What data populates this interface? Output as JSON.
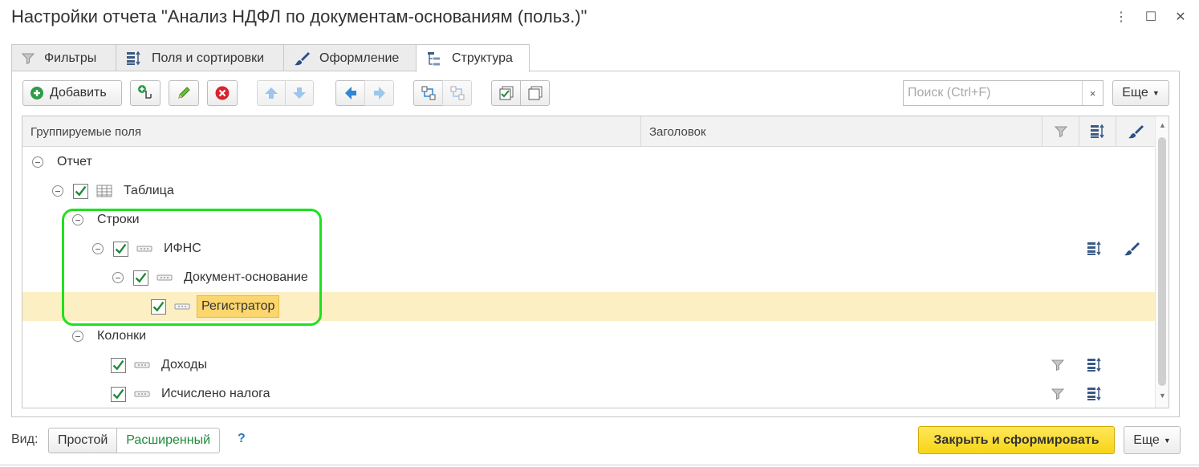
{
  "window": {
    "title": "Настройки отчета \"Анализ НДФЛ по документам-основаниям (польз.)\"",
    "menu_glyph": "⋮",
    "maximize_glyph": "☐",
    "close_glyph": "✕"
  },
  "tabs": [
    {
      "label": "Фильтры",
      "icon": "filter-icon",
      "active": false
    },
    {
      "label": "Поля и сортировки",
      "icon": "fields-sort-icon",
      "active": false
    },
    {
      "label": "Оформление",
      "icon": "brush-icon",
      "active": false
    },
    {
      "label": "Структура",
      "icon": "structure-icon",
      "active": true
    }
  ],
  "toolbar": {
    "add_label": "Добавить",
    "search_placeholder": "Поиск (Ctrl+F)",
    "search_value": "",
    "clear_glyph": "×",
    "more_label": "Еще"
  },
  "grid": {
    "columns": {
      "grouped_fields": "Группируемые поля",
      "header": "Заголовок"
    },
    "rows": [
      {
        "label": "Отчет",
        "toggle": true,
        "checkbox": false,
        "icon": null,
        "selected": false,
        "has_filter": false,
        "has_sort": false,
        "has_style": false
      },
      {
        "label": "Таблица",
        "toggle": true,
        "checkbox": true,
        "icon": "table-icon",
        "selected": false,
        "has_filter": false,
        "has_sort": false,
        "has_style": false
      },
      {
        "label": "Строки",
        "toggle": true,
        "checkbox": false,
        "icon": null,
        "selected": false,
        "has_filter": false,
        "has_sort": false,
        "has_style": false
      },
      {
        "label": "ИФНС",
        "toggle": true,
        "checkbox": true,
        "icon": "grouping-icon",
        "selected": false,
        "has_filter": false,
        "has_sort": true,
        "has_style": true
      },
      {
        "label": "Документ-основание",
        "toggle": true,
        "checkbox": true,
        "icon": "grouping-icon",
        "selected": false,
        "has_filter": false,
        "has_sort": false,
        "has_style": false
      },
      {
        "label": "Регистратор",
        "toggle": false,
        "checkbox": true,
        "icon": "grouping-icon",
        "selected": true,
        "has_filter": false,
        "has_sort": false,
        "has_style": false
      },
      {
        "label": "Колонки",
        "toggle": true,
        "checkbox": false,
        "icon": null,
        "selected": false,
        "has_filter": false,
        "has_sort": false,
        "has_style": false
      },
      {
        "label": "Доходы",
        "toggle": false,
        "checkbox": true,
        "icon": "grouping-icon",
        "selected": false,
        "has_filter": true,
        "has_sort": true,
        "has_style": false
      },
      {
        "label": "Исчислено налога",
        "toggle": false,
        "checkbox": true,
        "icon": "grouping-icon",
        "selected": false,
        "has_filter": true,
        "has_sort": true,
        "has_style": false
      }
    ]
  },
  "footer": {
    "view_label": "Вид:",
    "view_simple": "Простой",
    "view_extended": "Расширенный",
    "view_selected": "Расширенный",
    "help_label": "?",
    "primary_label": "Закрыть и сформировать",
    "more_label": "Еще"
  },
  "colors": {
    "accent_green": "#1d8a3a",
    "primary_yellow": "#f7d417",
    "selected_row": "#fbefc3",
    "highlight_frame": "#20e020"
  }
}
